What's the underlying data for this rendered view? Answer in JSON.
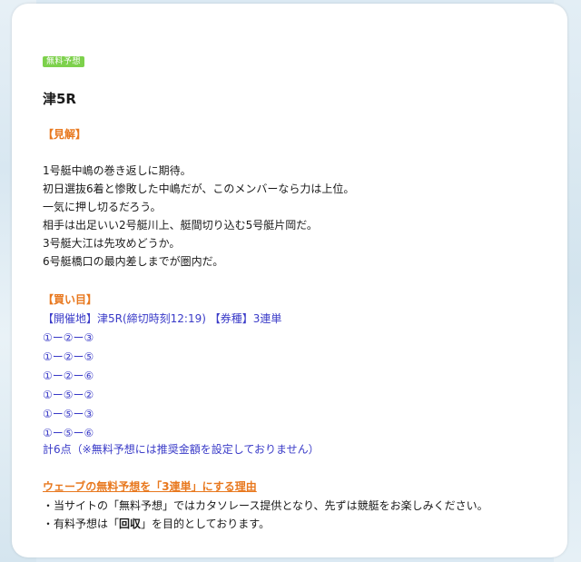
{
  "badge": "無料予想",
  "race_title": "津5R",
  "opinion_heading": "【見解】",
  "opinion_lines": [
    "1号艇中嶋の巻き返しに期待。",
    "初日選抜6着と惨敗した中嶋だが、このメンバーなら力は上位。",
    "一気に押し切るだろう。",
    "相手は出足いい2号艇川上、艇間切り込む5号艇片岡だ。",
    "3号艇大江は先攻めどうか。",
    "6号艇橋口の最内差しまでが圏内だ。"
  ],
  "buy_heading": "【買い目】",
  "venue_line": "【開催地】津5R(締切時刻12:19) 【券種】3連単",
  "bets": [
    "①ー②ー③",
    "①ー②ー⑤",
    "①ー②ー⑥",
    "①ー⑤ー②",
    "①ー⑤ー③",
    "①ー⑤ー⑥"
  ],
  "total_line": "計6点（※無料予想には推奨金額を設定しておりません）",
  "reason_heading": "ウェーブの無料予想を「3連単」にする理由",
  "reason_line1": "・当サイトの「無料予想」ではカタソレース提供となり、先ずは競艇をお楽しみください。",
  "reason_line2_pre": "・有料予想は「",
  "reason_line2_bold": "回収",
  "reason_line2_post": "」を目的としております。",
  "colors": {
    "badge": "#7dd14c",
    "heading": "#e8781e",
    "link": "#3a3bc8"
  }
}
